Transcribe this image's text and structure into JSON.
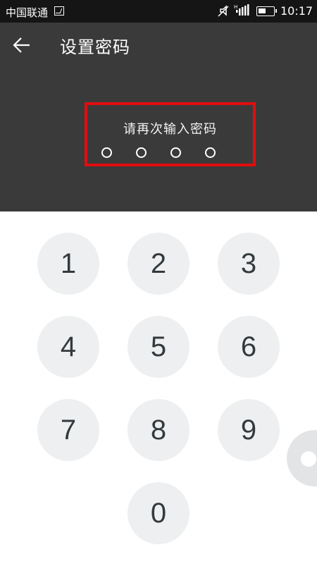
{
  "status_bar": {
    "carrier": "中国联通",
    "time": "10:17",
    "icons": [
      "image-icon",
      "mute-icon",
      "signal-icon",
      "battery-icon"
    ]
  },
  "app_bar": {
    "back_icon": "arrow-left-icon",
    "title": "设置密码"
  },
  "prompt": {
    "text": "请再次输入密码",
    "dot_count": 4,
    "highlight_color": "#e10d0d"
  },
  "keypad": {
    "keys": [
      "1",
      "2",
      "3",
      "4",
      "5",
      "6",
      "7",
      "8",
      "9",
      "0"
    ]
  },
  "colors": {
    "status_bar_bg": "#151515",
    "header_bg": "#3b3a3b",
    "key_bg": "#eeeff0",
    "key_text": "#333a3e"
  }
}
